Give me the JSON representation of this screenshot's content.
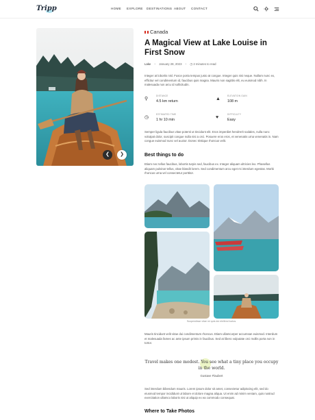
{
  "header": {
    "logo": "Tripp",
    "nav": [
      "HOME",
      "EXPLORE",
      "DESTINATIONS",
      "ABOUT",
      "CONTACT"
    ],
    "icons": [
      "search-icon",
      "sun-icon",
      "menu-icon"
    ]
  },
  "article": {
    "country": "Canada",
    "title": "A Magical View at Lake Louise in First Snow",
    "category": "Lake",
    "date": "January 28, 2023",
    "read_time": "2 minutes to read",
    "intro": "Integer at lobortis nisl. Fusce porta tempus justo at congue. Integer quis nisi neque. Nullam nunc ex, efficitur vel condimentum id, faucibus quis magna. Mauris non sagittis elit, eu euismod nibh. In malesuada non arcu id sollicitudin.",
    "stats": [
      {
        "label": "DISTANCE",
        "value": "4.5 km return",
        "icon": "distance-icon"
      },
      {
        "label": "ELEVATION GAIN",
        "value": "108 m",
        "icon": "mountain-icon"
      },
      {
        "label": "ESTIMATED TIME",
        "value": "1 hr 10 min",
        "icon": "clock-icon"
      },
      {
        "label": "DIFFICULTY",
        "value": "Easy",
        "icon": "difficulty-icon"
      }
    ],
    "para2": "Semper ligula faucibus vitae potenti ut tincidunt elit. Eros imperdiet hendrerit sodales, nulla nunc volutpat dolor, suscipit congue nulla nisi a orci. Posuere eros eros, et venenatis urna venenatis in. Nam congue euismod nunc vel auctor. Donec tristique rhoncus velit.",
    "best_heading": "Best things to do",
    "best_text": "Etiam nec tellus faucibus, lobortis turpis sed, faucibus ex. Integer aliquam ultricies leo. Phasellus aliquam pulvinar tellus, vitae blandit lorem. Sed condimentum arcu eget mi interdum egestas. Morbi rhoncus urna vel consectetur porttitor.",
    "caption": "Suspendisse vitae mi quis dui eleifend luctus.",
    "para3": "Mauris tincidunt velit vitae dui condimentum rhoncus. Etiam ullamcorper accumsan euismod. Interdum et malesuada fames ac ante ipsum primis in faucibus. Sed at libero vulputate orci mollis porta non in tortor.",
    "quote": "Travel makes one modest. You see what a tiny place you occupy in the world.",
    "quote_author": "Gustave Flaubert",
    "para4": "Sed interdum bibendum mauris. Lorem ipsum dolor sit amet, consectetur adipiscing elit, sed do eiusmod tempor incididunt ut labore et dolore magna aliqua. Ut enim ad minim veniam, quis nostrud exercitation ullamco laboris nisi ut aliquip ex ea commodo consequat.",
    "where_heading": "Where to Take Photos"
  },
  "colors": {
    "accent": "#8bd3e6",
    "flag_red": "#d52b1e"
  }
}
